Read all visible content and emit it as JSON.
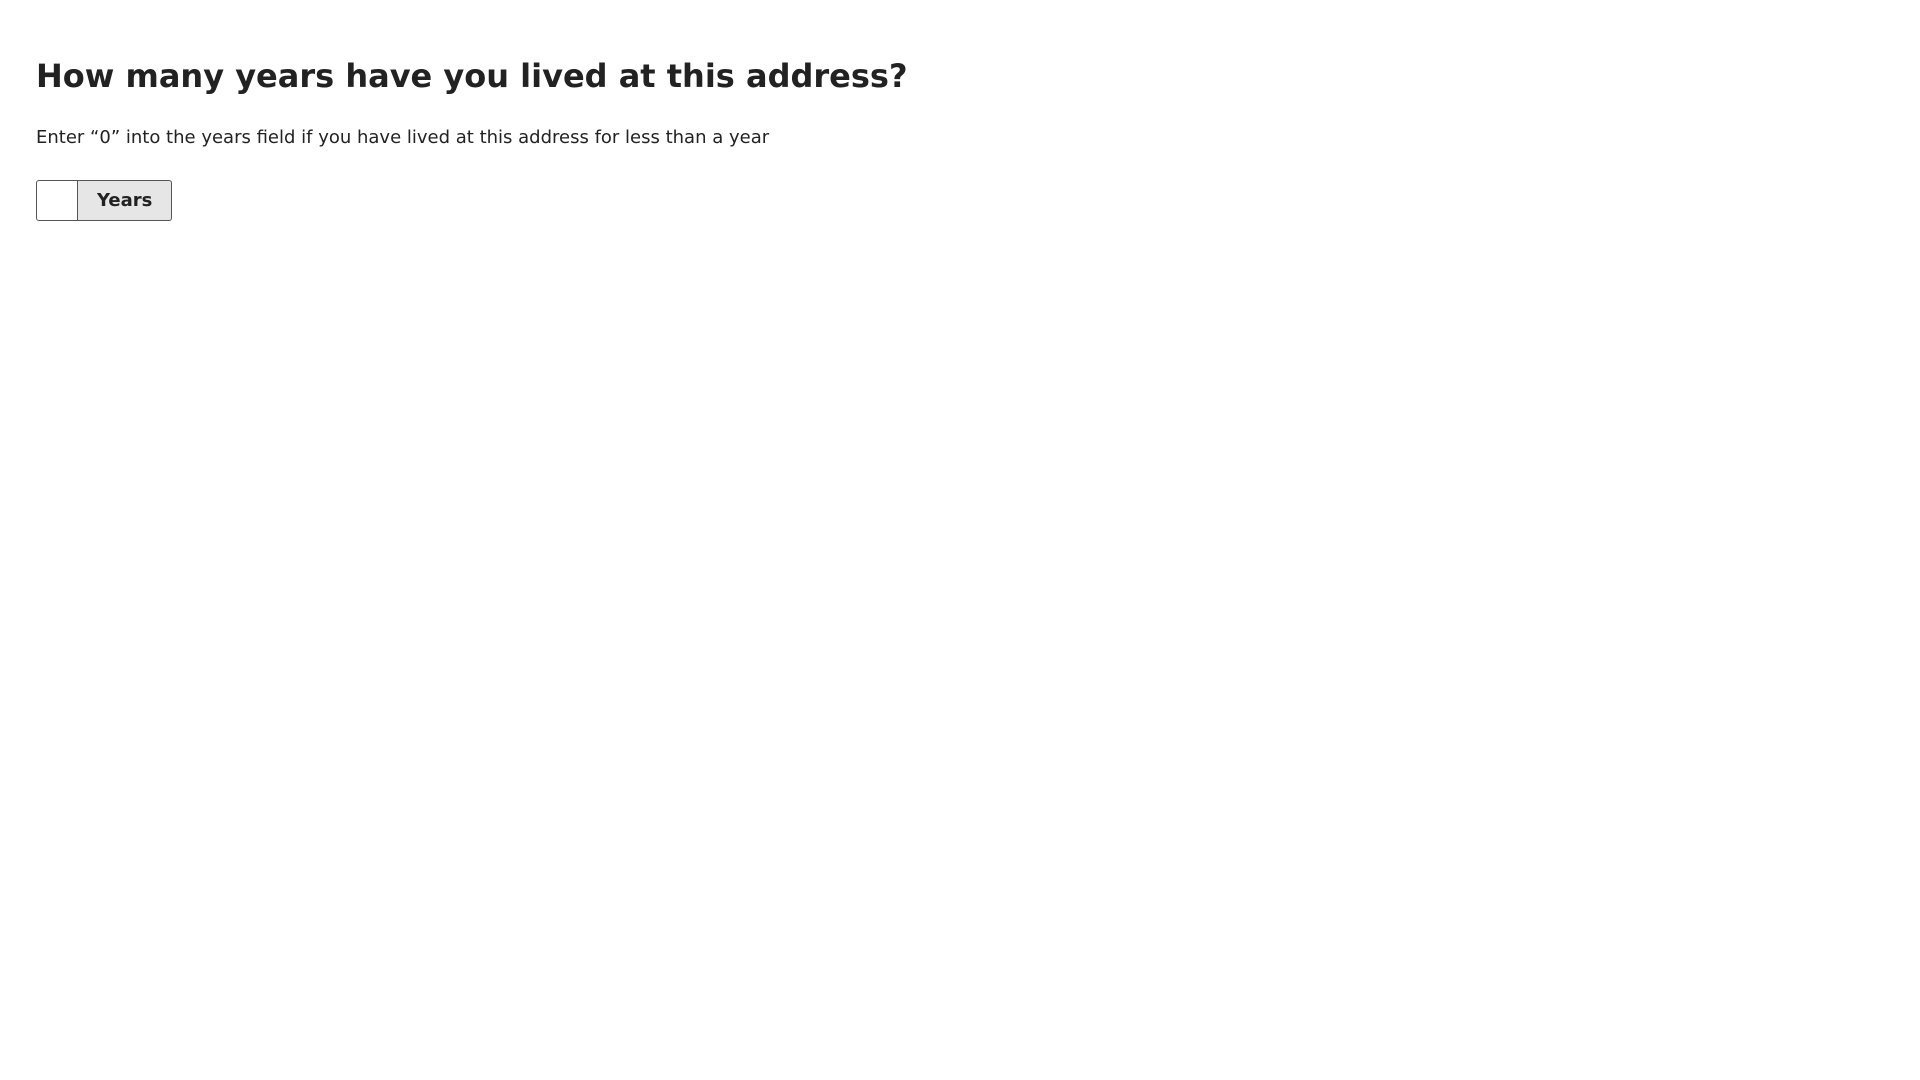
{
  "question": {
    "title": "How many years have you lived at this address?",
    "hint": "Enter “0” into the years field if you have lived at this address for less than a year"
  },
  "years_field": {
    "value": "",
    "placeholder": "",
    "unit_label": "Years"
  },
  "colors": {
    "text": "#222222",
    "border": "#555555",
    "unit_background": "#e6e6e6",
    "page_background": "#ffffff"
  }
}
